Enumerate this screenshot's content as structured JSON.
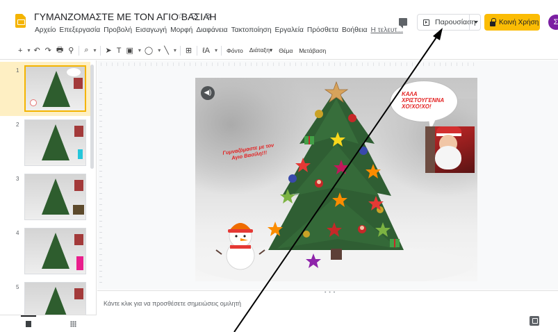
{
  "app": {
    "title": "ΓΥΜΑΝΖΟΜΑΣΤΕ ΜΕ ΤΟΝ ΑΓΙΟ ΒΑΣΙΛΗ",
    "title_icons": [
      "star-icon",
      "folder-move-icon",
      "cloud-status-icon"
    ],
    "accent_color": "#f4b400"
  },
  "menu": [
    "Αρχείο",
    "Επεξεργασία",
    "Προβολή",
    "Εισαγωγή",
    "Μορφή",
    "Διαφάνεια",
    "Τακτοποίηση",
    "Εργαλεία",
    "Πρόσθετα",
    "Βοήθεια",
    "Η τελευτ..."
  ],
  "header_buttons": {
    "present": "Παρουσίαση",
    "share": "Κοινή Χρήση",
    "share_color": "#fbbc04",
    "avatar_initial": "Σ",
    "avatar_color": "#7b1fa2"
  },
  "toolbar": {
    "glyphs": {
      "new": "+",
      "dropdown": "▾",
      "undo": "↶",
      "redo": "↷",
      "print": "🖶",
      "paint": "⚲",
      "zoom": "⌕",
      "select": "➤",
      "textbox": "T",
      "image": "▣",
      "shape": "◯",
      "line": "╲",
      "comment": "⊞",
      "format": "ℓA"
    },
    "background": "Φόντο",
    "layout": "Διάταξη",
    "theme": "Θέμα",
    "transition": "Μετάβαση"
  },
  "filmstrip": {
    "slides": [
      {
        "number": "1"
      },
      {
        "number": "2"
      },
      {
        "number": "3"
      },
      {
        "number": "4"
      },
      {
        "number": "5"
      }
    ],
    "selected_index": 0
  },
  "slide": {
    "bubble_text": "ΚΑΛΑ ΧΡΙΣΤΟΥΓΕΝΝΑ ΧΟ!ΧΟ!ΧΟ!",
    "caption": "Γυμναζόμαστε με τον Αγιο Βασίλη!!!",
    "text_color": "#e32020"
  },
  "notes": {
    "placeholder": "Κάντε κλικ για να προσθέσετε σημειώσεις ομιλητή"
  }
}
